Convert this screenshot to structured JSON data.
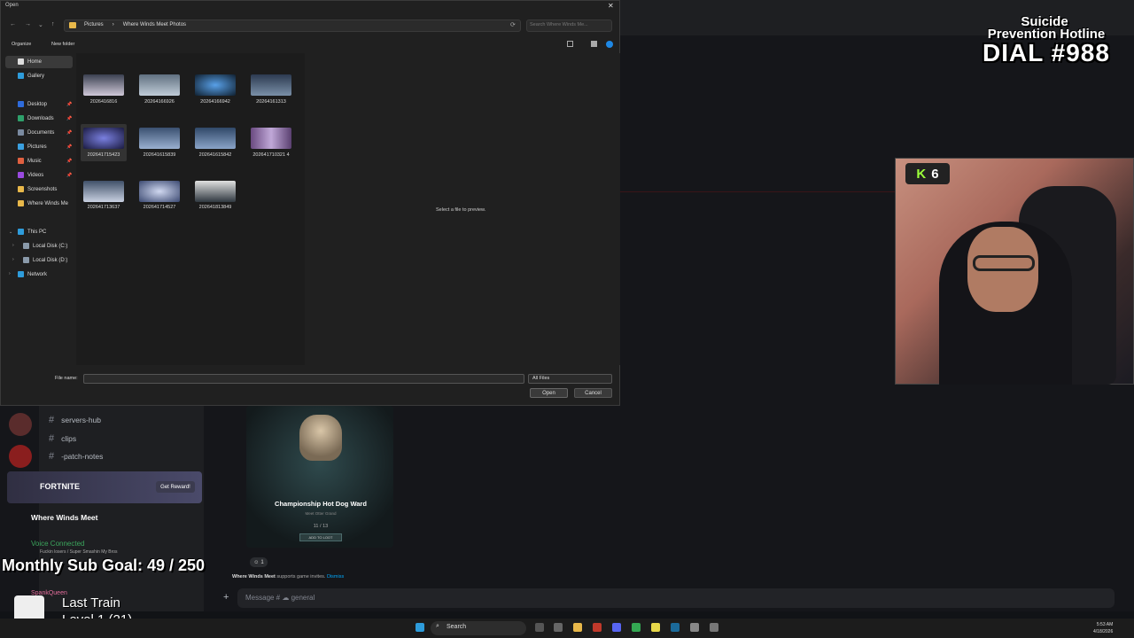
{
  "dialog": {
    "title": "Open",
    "breadcrumbs": [
      "Pictures",
      "Where Winds Meet Photos"
    ],
    "search_placeholder": "Search Where Winds Me...",
    "toolbar": {
      "organize": "Organize",
      "new_folder": "New folder"
    },
    "nav": [
      {
        "label": "Home"
      },
      {
        "label": "Gallery"
      },
      {
        "label": "Desktop"
      },
      {
        "label": "Downloads"
      },
      {
        "label": "Documents"
      },
      {
        "label": "Pictures"
      },
      {
        "label": "Music"
      },
      {
        "label": "Videos"
      },
      {
        "label": "Screenshots"
      },
      {
        "label": "Where Winds Me"
      },
      {
        "label": "This PC"
      },
      {
        "label": "Local Disk (C:)"
      },
      {
        "label": "Local Disk (D:)"
      },
      {
        "label": "Network"
      }
    ],
    "files": [
      "2026416816",
      "20264166926",
      "20264166942",
      "20264161313",
      "202641715423",
      "202641615839",
      "202641615842",
      "202641710321 4",
      "202641713637",
      "202641714527",
      "202641813849"
    ],
    "preview_text": "Select a file to preview.",
    "file_name_label": "File name:",
    "file_name_value": "",
    "file_type": "All Files",
    "open_label": "Open",
    "cancel_label": "Cancel"
  },
  "discord": {
    "channels": [
      "servers-hub",
      "clips",
      "-patch-notes"
    ],
    "banner_title": "FORTNITE",
    "banner_button": "Get Reward!",
    "server_name": "Where Winds Meet",
    "voice_status": "Voice Connected",
    "voice_channel": "Fuckin losers / Super Smashin My Bros",
    "user_name": "SpankQueen",
    "message_placeholder": "Message # ☁ general",
    "card_title": "Championship Hot Dog Ward",
    "card_subtitle": "Meet Otter Grand",
    "card_count": "11 / 13",
    "card_button": "ADD TO LOOT",
    "invite_game": "Where Winds Meet",
    "invite_text": "supports game invites.",
    "invite_dismiss": "Dismiss",
    "reaction_count": "1"
  },
  "overlay": {
    "hotline_line1": "Suicide",
    "hotline_line2": "Prevention Hotline",
    "hotline_line3": "DIAL #988",
    "sub_goal": "Monthly Sub Goal: 49 / 250",
    "song": "Last Train",
    "level": "Level 1 (21)",
    "kill_badge": "6"
  },
  "taskbar": {
    "search": "Search",
    "time": "5:53 AM",
    "date": "4/18/2026"
  }
}
